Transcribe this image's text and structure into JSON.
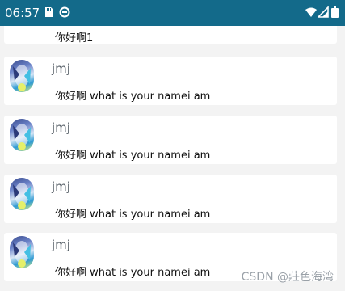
{
  "status_bar": {
    "time": "06:57",
    "icons": [
      "sd-card-icon",
      "sync-icon",
      "wifi-icon",
      "signal-icon",
      "battery-icon"
    ],
    "background": "#136a8a"
  },
  "messages": [
    {
      "name": "",
      "text": "你好啊1",
      "avatar": "anime-avatar"
    },
    {
      "name": "jmj",
      "text": "你好啊 what is your namei am",
      "avatar": "anime-avatar"
    },
    {
      "name": "jmj",
      "text": "你好啊 what is your namei am",
      "avatar": "anime-avatar"
    },
    {
      "name": "jmj",
      "text": "你好啊 what is your namei am",
      "avatar": "anime-avatar"
    },
    {
      "name": "jmj",
      "text": "你好啊 what is your namei am",
      "avatar": "anime-avatar"
    }
  ],
  "watermark": "CSDN @莊色海湾"
}
